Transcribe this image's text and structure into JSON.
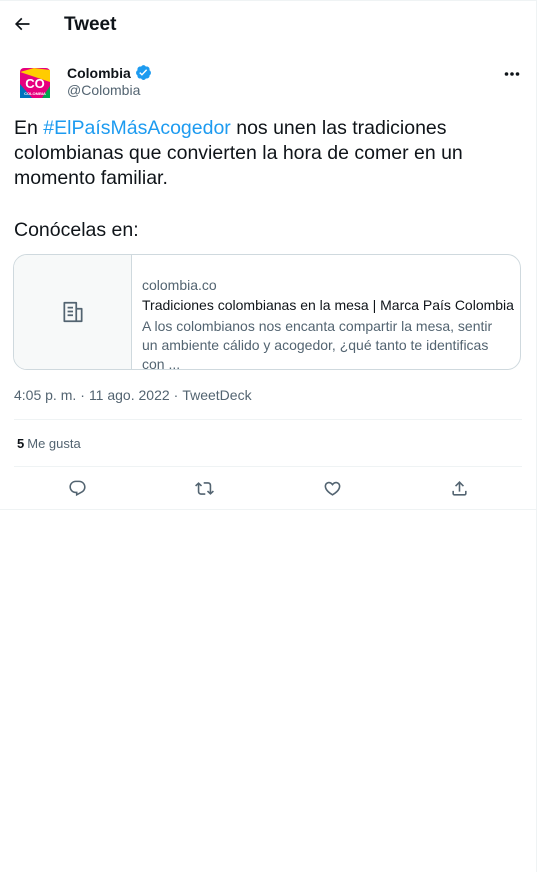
{
  "header": {
    "title": "Tweet",
    "back_icon": "arrow-left-icon"
  },
  "author": {
    "name": "Colombia",
    "handle": "@Colombia",
    "avatar_text": "CO",
    "avatar_subtext": "COLOMBIA",
    "verified_color": "#1d9bf0"
  },
  "tweet": {
    "text_prefix": "En ",
    "hashtag": "#ElPaísMásAcogedor",
    "text_suffix": " nos unen las tradiciones colombianas que convierten la hora de comer en un momento familiar.",
    "text_line2": "Conócelas en:"
  },
  "card": {
    "domain": "colombia.co",
    "title": "Tradiciones colombianas en la mesa | Marca País Colombia",
    "description": "A los colombianos nos encanta compartir la mesa, sentir un ambiente cálido y acogedor, ¿qué tanto te identificas con ...",
    "thumb_icon": "document-icon"
  },
  "meta": {
    "time": "4:05 p. m.",
    "sep": "·",
    "date": "11 ago. 2022",
    "source": "TweetDeck"
  },
  "stats": {
    "likes_count": "5",
    "likes_label": "Me gusta"
  },
  "actions": [
    "reply-icon",
    "retweet-icon",
    "like-icon",
    "share-icon"
  ],
  "colors": {
    "accent": "#1d9bf0",
    "secondary_text": "#536471",
    "border": "#cfd9de"
  }
}
